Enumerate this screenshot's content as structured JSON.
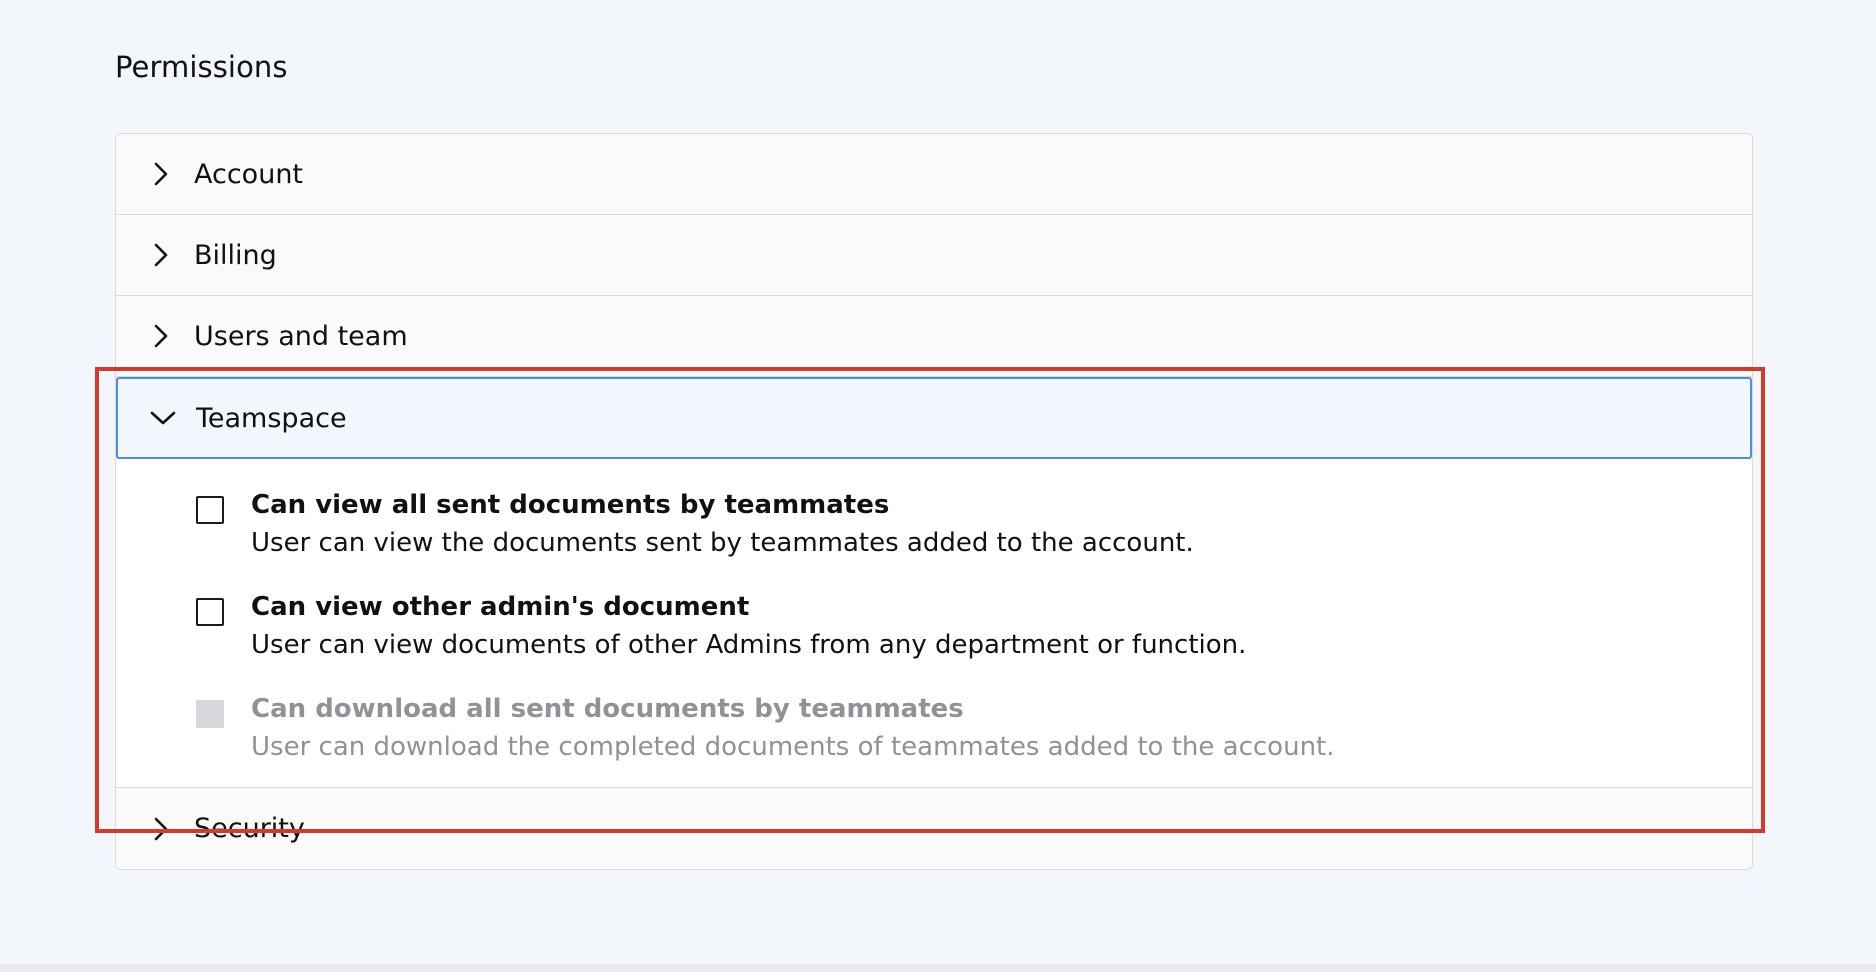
{
  "page": {
    "section_title": "Permissions"
  },
  "accordion": [
    {
      "label": "Account",
      "expanded": false,
      "icon": "chevron-right-icon"
    },
    {
      "label": "Billing",
      "expanded": false,
      "icon": "chevron-right-icon"
    },
    {
      "label": "Users and team",
      "expanded": false,
      "icon": "chevron-right-icon"
    },
    {
      "label": "Teamspace",
      "expanded": true,
      "icon": "chevron-down-icon"
    },
    {
      "label": "Security",
      "expanded": false,
      "icon": "chevron-right-icon"
    }
  ],
  "teamspace_permissions": [
    {
      "title": "Can view all sent documents by teammates",
      "description": "User can view the documents sent by teammates added to the account.",
      "checked": false,
      "disabled": false
    },
    {
      "title": "Can view other admin's document",
      "description": "User can view documents of other Admins from any department or function.",
      "checked": false,
      "disabled": false
    },
    {
      "title": "Can download all sent documents by teammates",
      "description": "User can download the completed documents of teammates added to the account.",
      "checked": false,
      "disabled": true
    }
  ],
  "colors": {
    "background": "#f3f7fc",
    "highlight_border": "#d33a2a",
    "expanded_border": "#4a8fe0",
    "disabled_text": "#8f9296"
  }
}
